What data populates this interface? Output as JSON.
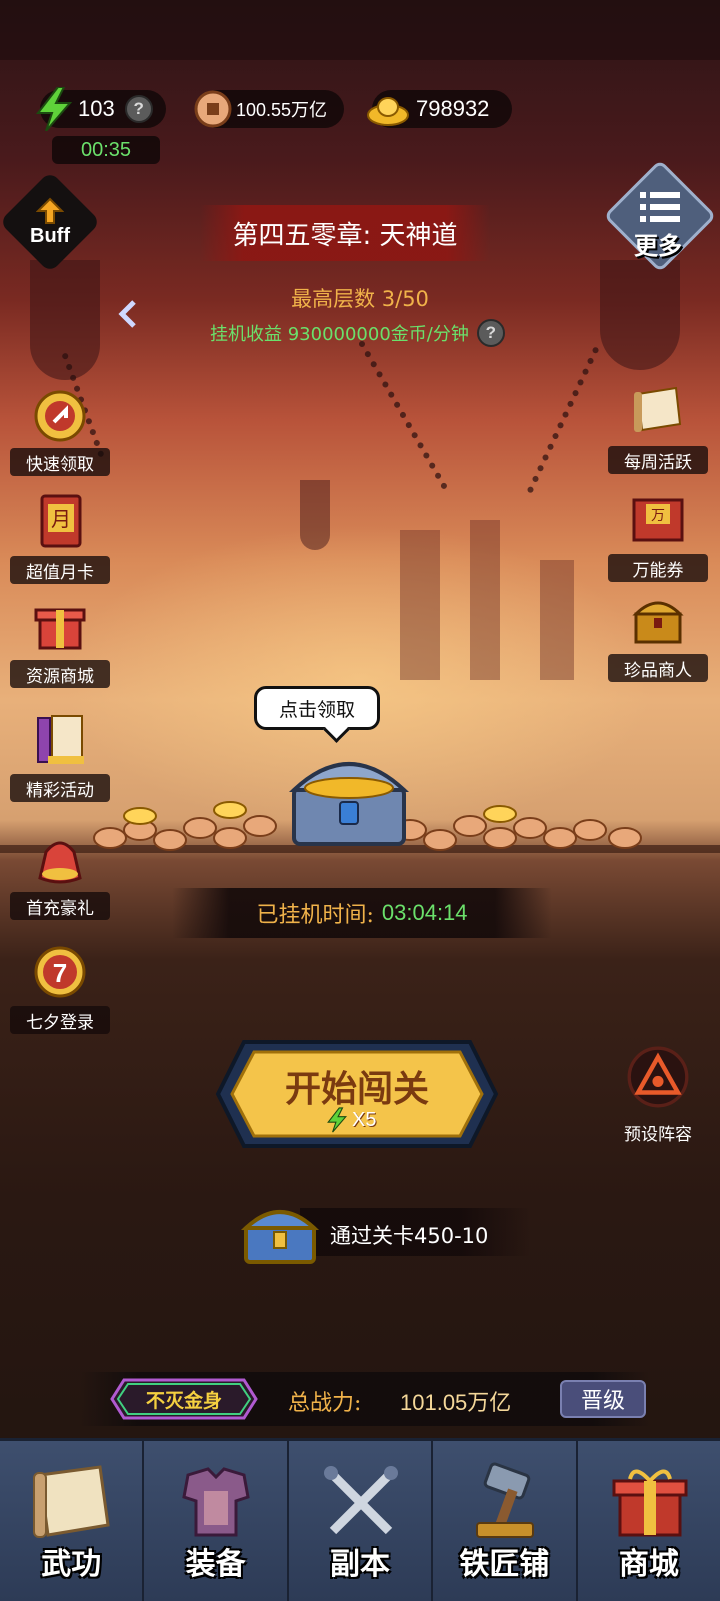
{
  "top_bar": {
    "energy_value": "103",
    "energy_timer": "00:35",
    "copper_value": "100.55万亿",
    "gold_value": "798932",
    "help_symbol": "?"
  },
  "buttons": {
    "buff_label": "Buff",
    "more_label": "更多"
  },
  "chapter": {
    "title": "第四五零章: 天神道",
    "max_floor": "最高层数 3/50",
    "income": "挂机收益 930000000金币/分钟"
  },
  "left_menu": [
    {
      "label": "快速领取",
      "icon": "quick-claim-icon"
    },
    {
      "label": "超值月卡",
      "icon": "month-card-icon"
    },
    {
      "label": "资源商城",
      "icon": "resource-shop-icon"
    },
    {
      "label": "精彩活动",
      "icon": "events-icon"
    },
    {
      "label": "首充豪礼",
      "icon": "first-charge-icon"
    },
    {
      "label": "七夕登录",
      "icon": "qixi-login-icon"
    }
  ],
  "right_menu": [
    {
      "label": "每周活跃",
      "icon": "weekly-active-icon"
    },
    {
      "label": "万能券",
      "icon": "universal-ticket-icon"
    },
    {
      "label": "珍品商人",
      "icon": "treasure-merchant-icon"
    },
    {
      "label": "预设阵容",
      "icon": "preset-lineup-icon"
    }
  ],
  "chest": {
    "bubble_text": "点击领取"
  },
  "afk": {
    "label": "已挂机时间:",
    "time": "03:04:14"
  },
  "start": {
    "label": "开始闯关",
    "cost": "X5"
  },
  "reward": {
    "text": "通过关卡450-10"
  },
  "power": {
    "badge": "不灭金身",
    "label": "总战力:",
    "value": "101.05万亿",
    "upgrade": "晋级"
  },
  "bottom_nav": [
    {
      "label": "武功",
      "icon": "martial-scroll-icon"
    },
    {
      "label": "装备",
      "icon": "armor-icon"
    },
    {
      "label": "副本",
      "icon": "crossed-swords-icon"
    },
    {
      "label": "铁匠铺",
      "icon": "hammer-icon"
    },
    {
      "label": "商城",
      "icon": "gift-box-icon"
    }
  ],
  "colors": {
    "green_text": "#6be06b",
    "gold_text": "#f0b24a",
    "nav_blue": "#3e4f6e",
    "start_gold": "#f4c44a"
  }
}
